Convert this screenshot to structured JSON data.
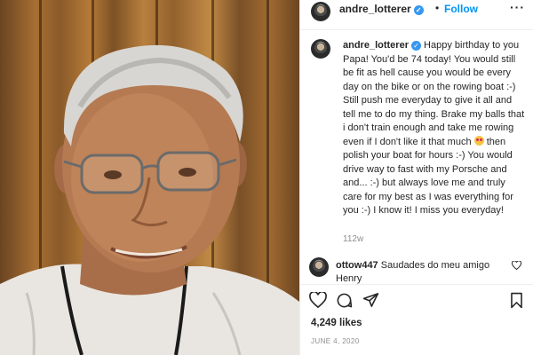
{
  "header": {
    "username": "andre_lotterer",
    "verified_mark": "✓",
    "separator": "•",
    "follow_label": "Follow",
    "more_label": "···"
  },
  "caption": {
    "username": "andre_lotterer",
    "text_part1": "Happy birthday to you Papa! You'd be 74 today! You would still be fit as hell cause you would be every day on the bike or on the rowing boat :-) Still push me everyday to give it all and tell me to do my thing. Brake my balls that i don't train enough and take me rowing even if I don't like it that much",
    "text_part2": "then polish your boat for hours :-) You would drive way to fast with my Porsche and and... :-) but always love me and truly care for my best as I was everything for you :-) I know it! I miss you everyday!",
    "emoji_icon": "smiling-face-with-hearts-icon",
    "time_ago": "112w"
  },
  "comment": {
    "username": "ottow447",
    "text": "Saudades do meu amigo Henry"
  },
  "actions": {
    "icons": [
      "heart-icon",
      "comment-icon",
      "share-icon",
      "bookmark-icon"
    ]
  },
  "likes": "4,249 likes",
  "date": "JUNE 4, 2020",
  "colors": {
    "link_blue": "#0095f6",
    "verified_blue": "#3897f0",
    "secondary_text": "#8e8e8e"
  }
}
